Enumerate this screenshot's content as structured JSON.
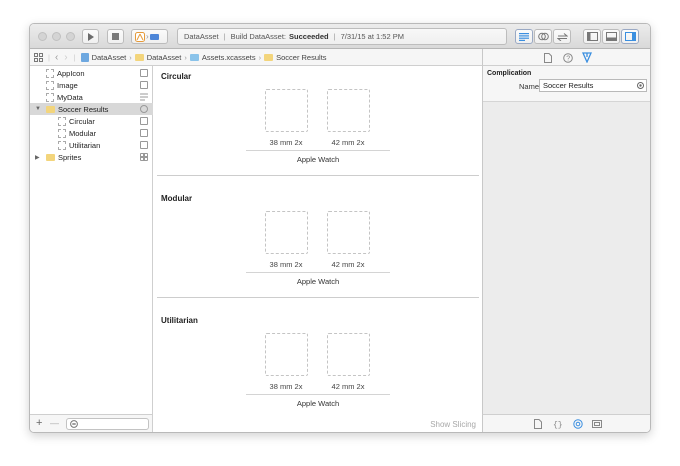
{
  "toolbar": {
    "scheme_target": "DataAsset",
    "activity_prefix": "Build DataAsset:",
    "activity_status": "Succeeded",
    "activity_time": "7/31/15 at 1:52 PM"
  },
  "jumpbar": {
    "items": [
      "DataAsset",
      "DataAsset",
      "Assets.xcassets",
      "Soccer Results"
    ]
  },
  "navigator": {
    "items": [
      {
        "label": "AppIcon"
      },
      {
        "label": "Image"
      },
      {
        "label": "MyData"
      },
      {
        "label": "Soccer Results"
      },
      {
        "label": "Circular"
      },
      {
        "label": "Modular"
      },
      {
        "label": "Utilitarian"
      },
      {
        "label": "Sprites"
      }
    ],
    "add_label": "+",
    "remove_label": "—"
  },
  "editor": {
    "sections": [
      {
        "title": "Circular",
        "slot1": "38 mm 2x",
        "slot2": "42 mm 2x",
        "group": "Apple Watch"
      },
      {
        "title": "Modular",
        "slot1": "38 mm 2x",
        "slot2": "42 mm 2x",
        "group": "Apple Watch"
      },
      {
        "title": "Utilitarian",
        "slot1": "38 mm 2x",
        "slot2": "42 mm 2x",
        "group": "Apple Watch"
      }
    ],
    "show_slicing": "Show Slicing"
  },
  "inspector": {
    "heading": "Complication",
    "name_label": "Name",
    "name_value": "Soccer Results"
  },
  "colors": {
    "selection": "#d8d8d8",
    "accent_blue": "#3b8fe0",
    "folder_yellow": "#f3d57c",
    "folder_blue": "#8ac3ea"
  }
}
